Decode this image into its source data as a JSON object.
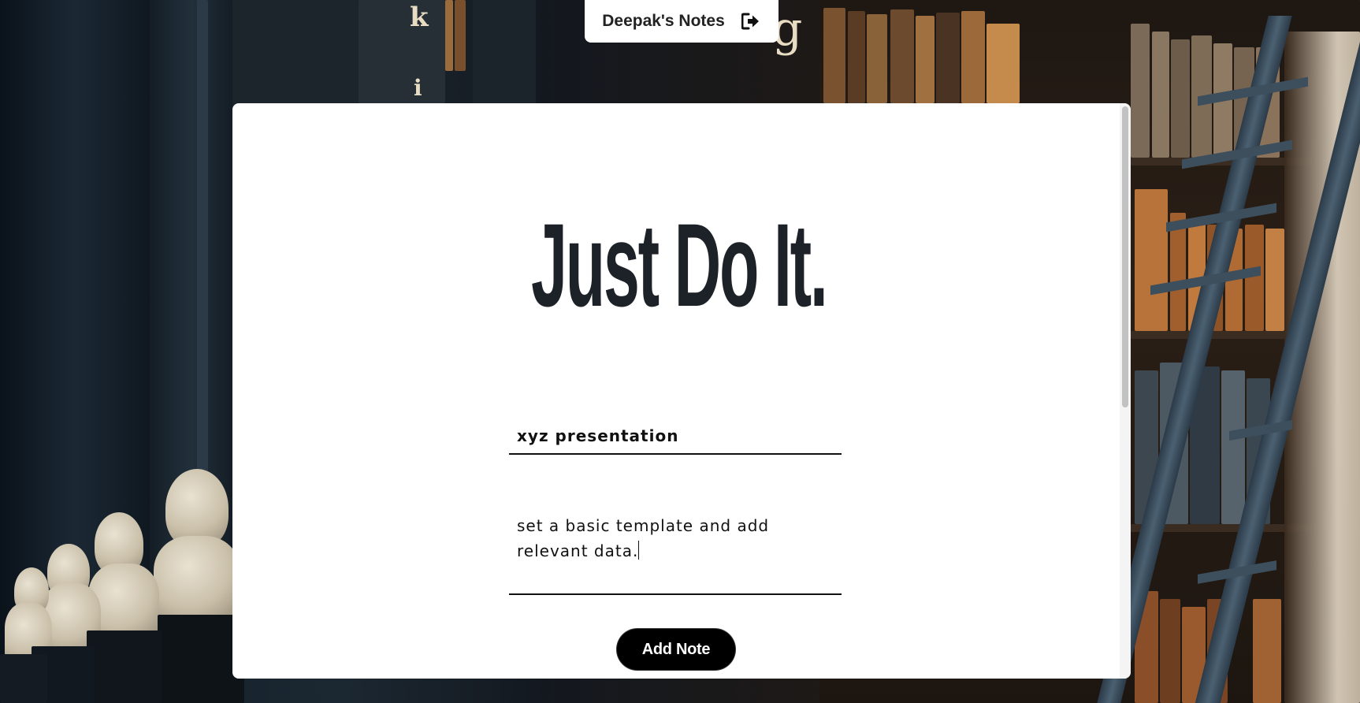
{
  "header": {
    "brand": "Deepak's Notes",
    "logout_icon": "sign-out-icon"
  },
  "main": {
    "headline": "Just Do It.",
    "note_title_value": "xyz presentation",
    "note_content_value": "set a basic template and add\nrelevant data.",
    "add_button_label": "Add Note"
  },
  "background": {
    "shelf_letters": [
      "k",
      "g",
      "i"
    ]
  },
  "colors": {
    "card": "#ffffff",
    "button": "#000000",
    "text": "#1d2228"
  }
}
